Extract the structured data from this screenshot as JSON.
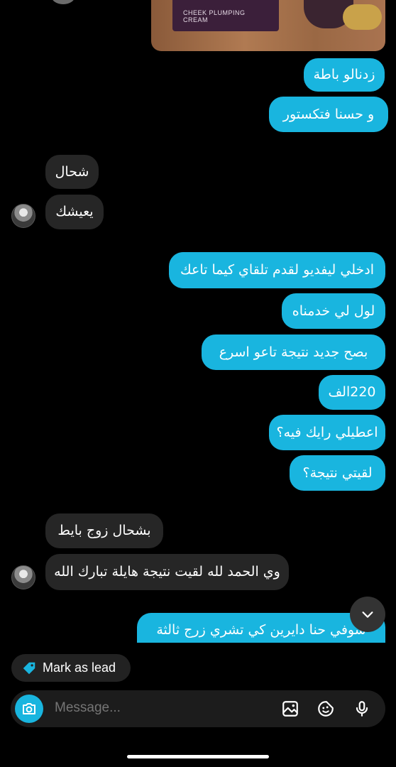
{
  "photo": {
    "product_text": "CHEEK PLUMPING\nCREAM"
  },
  "messages": [
    {
      "dir": "out",
      "text": "زدنالو باطة"
    },
    {
      "dir": "out",
      "text": "و حسنا فتكستور"
    },
    {
      "dir": "in",
      "text": "شحال"
    },
    {
      "dir": "in",
      "text": "يعيشك"
    },
    {
      "dir": "out",
      "text": "ادخلي ليفديو لقدم تلقاي كيما تاعك"
    },
    {
      "dir": "out",
      "text": "لول لي خدمناه"
    },
    {
      "dir": "out",
      "text": "بصح جديد نتيجة تاعو اسرع"
    },
    {
      "dir": "out",
      "text": "220الف"
    },
    {
      "dir": "out",
      "text": "اعطيلي رايك فيه؟"
    },
    {
      "dir": "out",
      "text": "لقيتي نتيجة؟"
    },
    {
      "dir": "in",
      "text": "بشحال زوج بايط"
    },
    {
      "dir": "in",
      "text": "وي الحمد لله لقيت نتيجة هايلة تبارك الله"
    },
    {
      "dir": "out",
      "text": "سوفي حنا دايرين كي تشري   زرج ثالثة"
    }
  ],
  "lead_button": {
    "label": "Mark as lead",
    "icon": "tag-icon"
  },
  "composer": {
    "placeholder": "Message...",
    "icons": [
      "camera-icon",
      "gallery-icon",
      "sticker-icon",
      "microphone-icon"
    ]
  },
  "colors": {
    "outgoing": "#19b5df",
    "incoming": "#262626",
    "background": "#000000"
  }
}
